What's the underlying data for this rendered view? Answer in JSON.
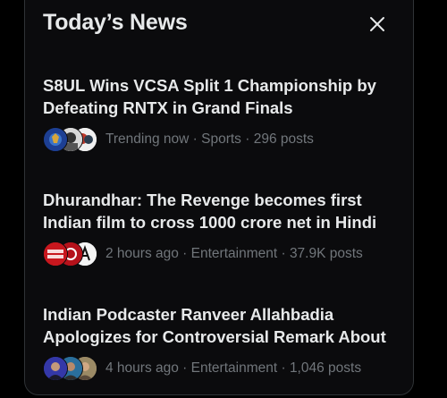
{
  "panel": {
    "title": "Today’s News",
    "close_icon": "close-icon"
  },
  "news": [
    {
      "headline": "S8UL Wins VCSA Split 1 Championship by Defeating RNTX in Grand Finals",
      "time": "Trending now",
      "category": "Sports",
      "posts": "296 posts",
      "avatars": [
        "team-logo-avatar",
        "player-avatar",
        "player-avatar"
      ]
    },
    {
      "headline": "Dhurandhar: The Revenge becomes first Indian film to cross 1000 crore net in Hindi",
      "time": "2 hours ago",
      "category": "Entertainment",
      "posts": "37.9K posts",
      "avatars": [
        "india-today-logo-avatar",
        "news-logo-avatar",
        "news-logo-avatar"
      ]
    },
    {
      "headline": "Indian Podcaster Ranveer Allahbadia Apologizes for Controversial Remark About",
      "time": "4 hours ago",
      "category": "Entertainment",
      "posts": "1,046 posts",
      "avatars": [
        "person-avatar",
        "person-avatar",
        "person-avatar"
      ]
    }
  ],
  "separator": " · ",
  "colors": {
    "background": "#000000",
    "card": "#0b0b0d",
    "text_primary": "#e7e9ea",
    "text_secondary": "#71767b",
    "border": "#2f3336"
  }
}
